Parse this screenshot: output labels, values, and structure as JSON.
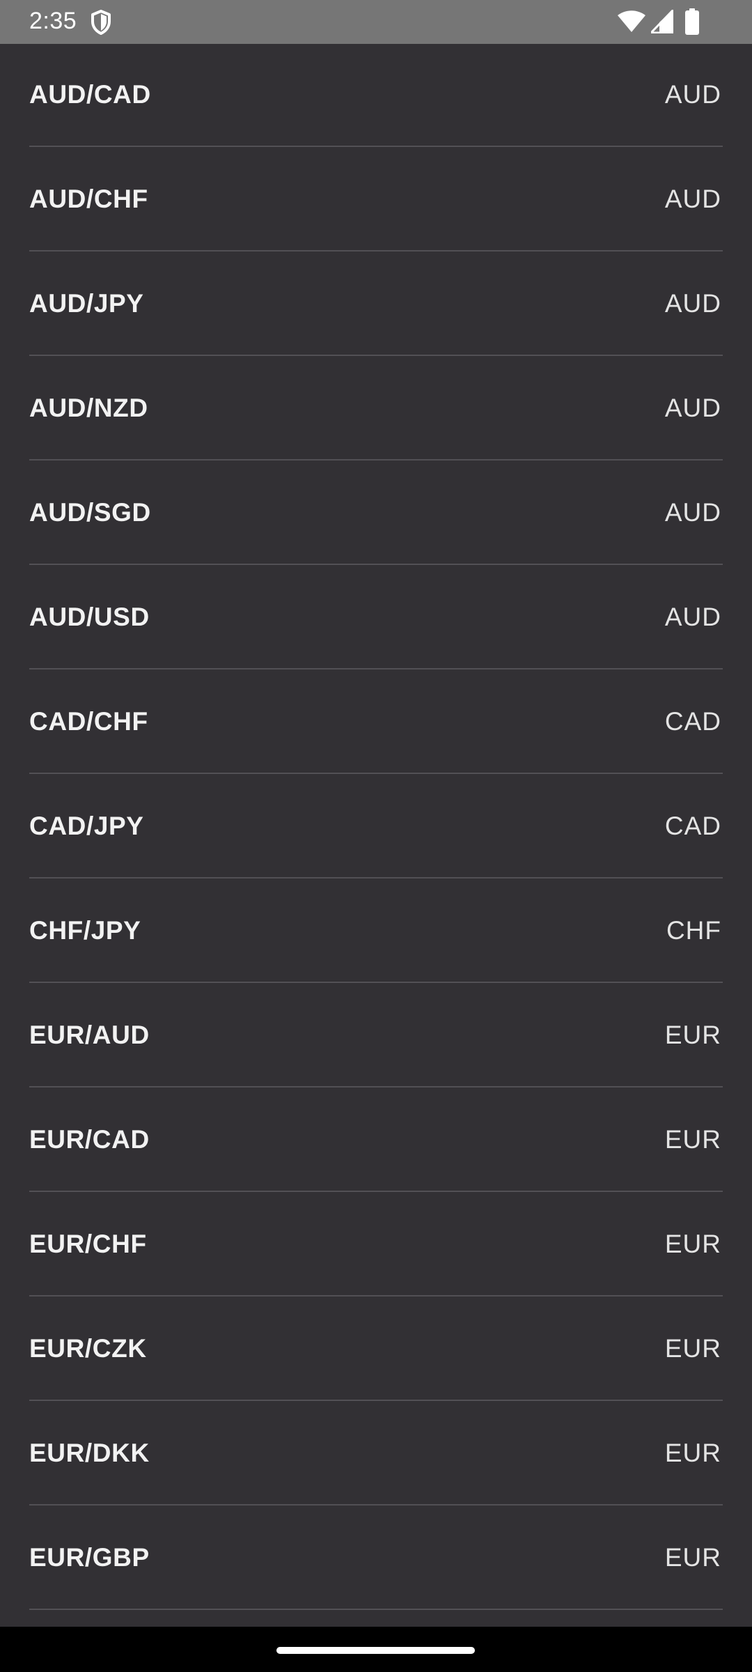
{
  "status_bar": {
    "time": "2:35",
    "icons": [
      "shield-icon",
      "wifi-icon",
      "signal-icon",
      "battery-icon"
    ]
  },
  "pairs": [
    {
      "symbol": "AUD/CAD",
      "base": "AUD"
    },
    {
      "symbol": "AUD/CHF",
      "base": "AUD"
    },
    {
      "symbol": "AUD/JPY",
      "base": "AUD"
    },
    {
      "symbol": "AUD/NZD",
      "base": "AUD"
    },
    {
      "symbol": "AUD/SGD",
      "base": "AUD"
    },
    {
      "symbol": "AUD/USD",
      "base": "AUD"
    },
    {
      "symbol": "CAD/CHF",
      "base": "CAD"
    },
    {
      "symbol": "CAD/JPY",
      "base": "CAD"
    },
    {
      "symbol": "CHF/JPY",
      "base": "CHF"
    },
    {
      "symbol": "EUR/AUD",
      "base": "EUR"
    },
    {
      "symbol": "EUR/CAD",
      "base": "EUR"
    },
    {
      "symbol": "EUR/CHF",
      "base": "EUR"
    },
    {
      "symbol": "EUR/CZK",
      "base": "EUR"
    },
    {
      "symbol": "EUR/DKK",
      "base": "EUR"
    },
    {
      "symbol": "EUR/GBP",
      "base": "EUR"
    }
  ],
  "colors": {
    "background": "#323034",
    "status_bar": "#767676",
    "divider": "#525055",
    "text": "#f2f2f2",
    "nav_bar": "#000000"
  }
}
